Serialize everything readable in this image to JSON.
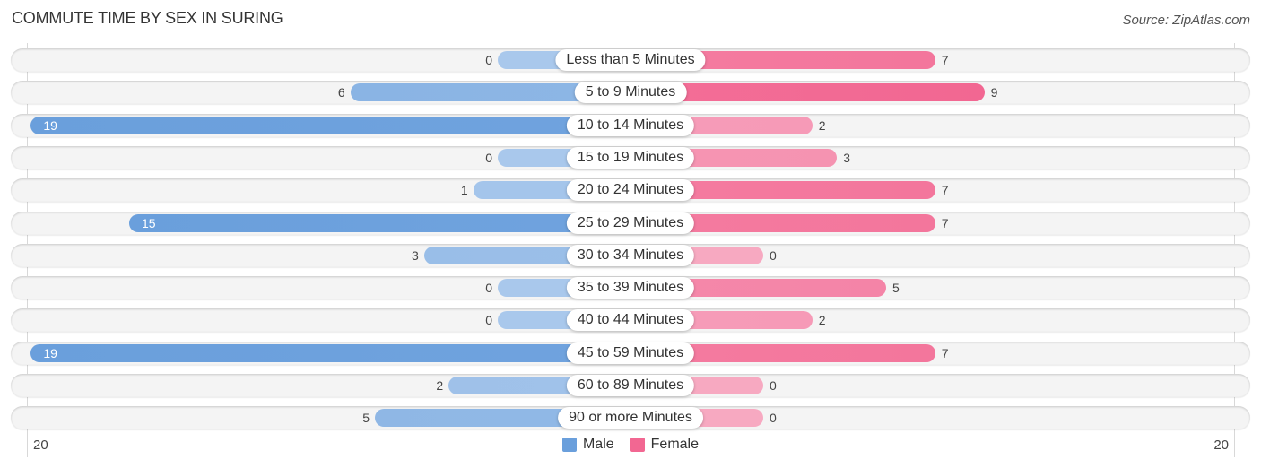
{
  "header": {
    "title": "COMMUTE TIME BY SEX IN SURING",
    "source": "Source: ZipAtlas.com"
  },
  "colors": {
    "male": "#6a9fdc",
    "male_light": "#a9c8ec",
    "female": "#f26792",
    "female_light": "#f7a9c1"
  },
  "chart_data": {
    "type": "bar",
    "orientation": "horizontal-diverging",
    "title": "COMMUTE TIME BY SEX IN SURING",
    "categories": [
      "Less than 5 Minutes",
      "5 to 9 Minutes",
      "10 to 14 Minutes",
      "15 to 19 Minutes",
      "20 to 24 Minutes",
      "25 to 29 Minutes",
      "30 to 34 Minutes",
      "35 to 39 Minutes",
      "40 to 44 Minutes",
      "45 to 59 Minutes",
      "60 to 89 Minutes",
      "90 or more Minutes"
    ],
    "series": [
      {
        "name": "Male",
        "values": [
          0,
          6,
          19,
          0,
          1,
          15,
          3,
          0,
          0,
          19,
          2,
          5
        ]
      },
      {
        "name": "Female",
        "values": [
          7,
          9,
          2,
          3,
          7,
          7,
          0,
          5,
          2,
          7,
          0,
          0
        ]
      }
    ],
    "axis": {
      "left_label": "20",
      "right_label": "20",
      "max": 20
    },
    "legend": {
      "position": "bottom-center",
      "items": [
        "Male",
        "Female"
      ]
    },
    "grid": false
  }
}
